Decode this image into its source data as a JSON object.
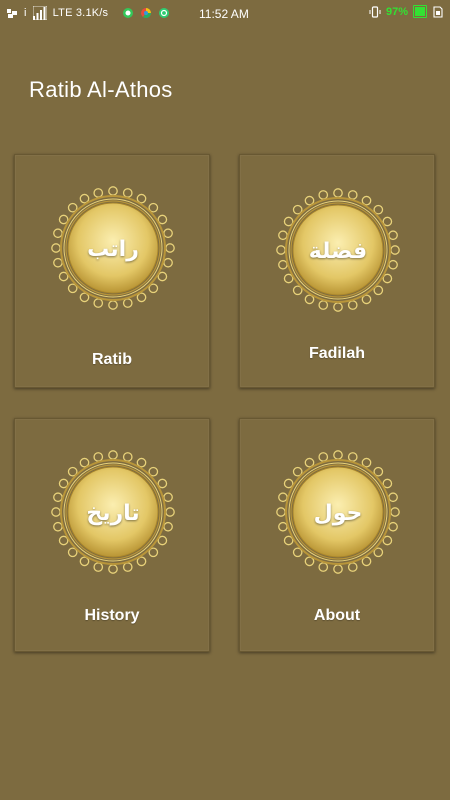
{
  "status_bar": {
    "network": "LTE 3.1K/s",
    "time": "11:52 AM",
    "battery": "97%",
    "indicator": "i"
  },
  "app": {
    "title": "Ratib Al-Athos"
  },
  "menu": [
    {
      "label": "Ratib",
      "arabic": "راتب",
      "icon": "ratib-medallion-icon"
    },
    {
      "label": "Fadilah",
      "arabic": "فضلة",
      "icon": "fadilah-medallion-icon"
    },
    {
      "label": "History",
      "arabic": "تاريخ",
      "icon": "history-medallion-icon"
    },
    {
      "label": "About",
      "arabic": "حول",
      "icon": "about-medallion-icon"
    }
  ],
  "colors": {
    "background": "#7d6b40",
    "gold": "#e8d27a",
    "gold_dark": "#b8953a",
    "battery": "#33e033"
  }
}
